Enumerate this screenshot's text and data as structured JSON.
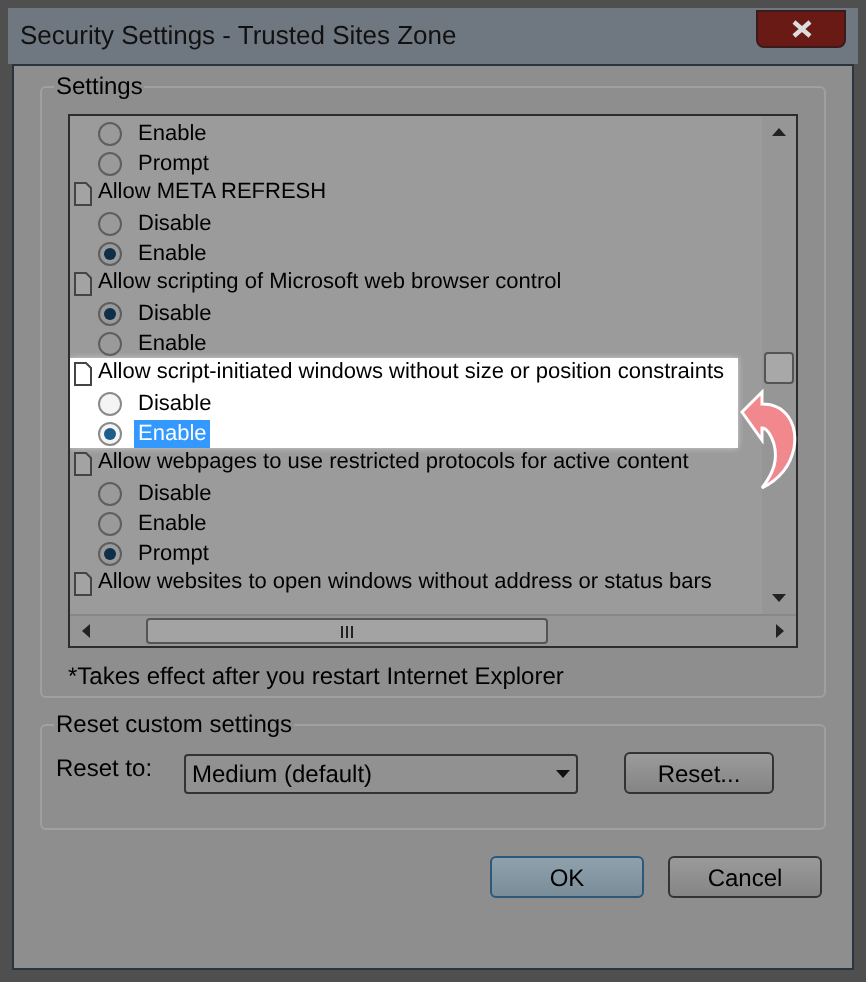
{
  "window": {
    "title": "Security Settings - Trusted Sites Zone"
  },
  "settings": {
    "label": "Settings",
    "groups": [
      {
        "highlighted": false,
        "options": [
          {
            "label": "Enable",
            "selected": false,
            "focused": false
          },
          {
            "label": "Prompt",
            "selected": false,
            "focused": false
          }
        ]
      },
      {
        "label": "Allow META REFRESH",
        "highlighted": false,
        "options": [
          {
            "label": "Disable",
            "selected": false,
            "focused": false
          },
          {
            "label": "Enable",
            "selected": true,
            "focused": false
          }
        ]
      },
      {
        "label": "Allow scripting of Microsoft web browser control",
        "highlighted": false,
        "options": [
          {
            "label": "Disable",
            "selected": true,
            "focused": false
          },
          {
            "label": "Enable",
            "selected": false,
            "focused": false
          }
        ]
      },
      {
        "label": "Allow script-initiated windows without size or position constraints",
        "highlighted": true,
        "options": [
          {
            "label": "Disable",
            "selected": false,
            "focused": false
          },
          {
            "label": "Enable",
            "selected": true,
            "focused": true
          }
        ]
      },
      {
        "label": "Allow webpages to use restricted protocols for active content",
        "highlighted": false,
        "options": [
          {
            "label": "Disable",
            "selected": false,
            "focused": false
          },
          {
            "label": "Enable",
            "selected": false,
            "focused": false
          },
          {
            "label": "Prompt",
            "selected": true,
            "focused": false
          }
        ]
      },
      {
        "label": "Allow websites to open windows without address or status bars",
        "highlighted": false
      }
    ],
    "footnote": "*Takes effect after you restart Internet Explorer"
  },
  "reset": {
    "label": "Reset custom settings",
    "field_label": "Reset to:",
    "value": "Medium (default)",
    "button": "Reset..."
  },
  "buttons": [
    "OK",
    "Cancel"
  ]
}
